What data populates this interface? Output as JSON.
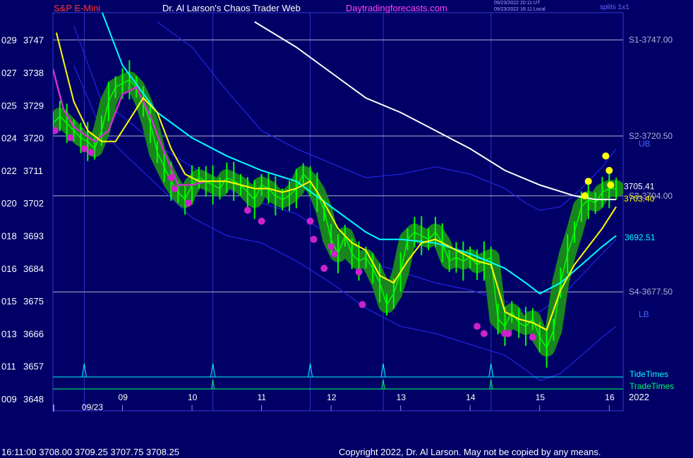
{
  "header": {
    "symbol": "S&P E-Mini",
    "source": "Dr. Al Larson's Chaos Trader Web",
    "site": "Daytradingforecasts.com",
    "time_utc": "09/23/2022 20:11 UT",
    "time_local": "09/23/2022 16:11 Local",
    "splits": "splits 1x1"
  },
  "footer": {
    "quote": "16:11:00  3708.00 3709.25 3707.75 3708.25",
    "copyright": "Copyright 2022, Dr. Al Larson. May not be copied by any means."
  },
  "colors": {
    "background": "#000066",
    "plot_border": "#3a3ad0",
    "price_bar": "#00ff00",
    "glow": "#1a8c1a",
    "mov_avg_fast": "#ffff00",
    "mov_avg_mid": "#00ffff",
    "mov_avg_slow": "#ffffff",
    "mov_avg_magenta": "#cc33cc",
    "band_lines": "#2222dd",
    "support_lines": "#b0b0d8",
    "tide_times": "#00ffff",
    "trade_times": "#00ff66"
  },
  "chart_data": {
    "type": "line",
    "title": "S&P E-Mini",
    "ylim": [
      3648,
      3752
    ],
    "xlim": [
      8.0,
      16.2
    ],
    "y_ticks": [
      {
        "code": "029",
        "price": "3747",
        "v": 3747
      },
      {
        "code": "027",
        "price": "3738",
        "v": 3738
      },
      {
        "code": "025",
        "price": "3729",
        "v": 3729
      },
      {
        "code": "024",
        "price": "3720",
        "v": 3720
      },
      {
        "code": "022",
        "price": "3711",
        "v": 3711
      },
      {
        "code": "020",
        "price": "3702",
        "v": 3702
      },
      {
        "code": "018",
        "price": "3693",
        "v": 3693
      },
      {
        "code": "016",
        "price": "3684",
        "v": 3684
      },
      {
        "code": "015",
        "price": "3675",
        "v": 3675
      },
      {
        "code": "013",
        "price": "3666",
        "v": 3666
      },
      {
        "code": "011",
        "price": "3657",
        "v": 3657
      },
      {
        "code": "009",
        "price": "3648",
        "v": 3648
      }
    ],
    "x_ticks": [
      {
        "label": "09",
        "x": 9
      },
      {
        "label": "10",
        "x": 10
      },
      {
        "label": "11",
        "x": 11
      },
      {
        "label": "12",
        "x": 12
      },
      {
        "label": "13",
        "x": 13
      },
      {
        "label": "14",
        "x": 14
      },
      {
        "label": "15",
        "x": 15
      },
      {
        "label": "16",
        "x": 16
      }
    ],
    "date_label": "09/23",
    "year_label": "2022",
    "levels": [
      {
        "label": "S1-3747.00",
        "value": 3747.0
      },
      {
        "label": "S2-3720.50",
        "value": 3720.5
      },
      {
        "label": "S3-3704.00",
        "value": 3704.0
      },
      {
        "label": "S4-3677.50",
        "value": 3677.5
      }
    ],
    "band_labels": {
      "upper": "UB",
      "lower": "LB"
    },
    "value_labels": [
      {
        "text": "3692.51",
        "value": 3692.51,
        "color": "#00ffff"
      },
      {
        "text": "3705.41",
        "value": 3705.41,
        "color": "#ffffff"
      },
      {
        "text": "3703.40",
        "value": 3703.4,
        "color": "#ffff00"
      }
    ],
    "tide_times_label": "TideTimes",
    "trade_times_label": "TradeTimes",
    "tide_times": [
      8.45,
      10.3,
      11.7,
      12.75,
      14.3
    ],
    "trade_times": [
      10.3,
      12.75,
      14.3
    ],
    "vlines": [
      8.45,
      10.3,
      11.7,
      12.75,
      14.3
    ],
    "series": [
      {
        "type": "price",
        "x": [
          8.0,
          8.1,
          8.2,
          8.3,
          8.4,
          8.5,
          8.6,
          8.7,
          8.8,
          8.9,
          9.0,
          9.1,
          9.2,
          9.3,
          9.4,
          9.5,
          9.6,
          9.7,
          9.8,
          9.9,
          10.0,
          10.1,
          10.2,
          10.3,
          10.4,
          10.5,
          10.6,
          10.7,
          10.8,
          10.9,
          11.0,
          11.1,
          11.2,
          11.3,
          11.4,
          11.5,
          11.6,
          11.7,
          11.8,
          11.9,
          12.0,
          12.1,
          12.2,
          12.3,
          12.4,
          12.5,
          12.6,
          12.7,
          12.8,
          12.9,
          13.0,
          13.1,
          13.2,
          13.3,
          13.4,
          13.5,
          13.6,
          13.7,
          13.8,
          13.9,
          14.0,
          14.1,
          14.2,
          14.3,
          14.4,
          14.5,
          14.6,
          14.7,
          14.8,
          14.9,
          15.0,
          15.1,
          15.2,
          15.3,
          15.4,
          15.5,
          15.6,
          15.7,
          15.8,
          15.9,
          16.0,
          16.1
        ],
        "y": [
          3724,
          3726,
          3724,
          3722,
          3720,
          3719,
          3717,
          3722,
          3730,
          3734,
          3735,
          3736,
          3734,
          3730,
          3724,
          3716,
          3712,
          3708,
          3705,
          3703,
          3707,
          3709,
          3708,
          3707,
          3706,
          3709,
          3708,
          3707,
          3705,
          3703,
          3707,
          3706,
          3704,
          3703,
          3704,
          3706,
          3710,
          3708,
          3705,
          3700,
          3692,
          3688,
          3693,
          3688,
          3686,
          3687,
          3684,
          3680,
          3674,
          3677,
          3683,
          3692,
          3694,
          3693,
          3692,
          3694,
          3691,
          3686,
          3687,
          3686,
          3687,
          3685,
          3686,
          3687,
          3670,
          3668,
          3672,
          3669,
          3668,
          3670,
          3665,
          3662,
          3667,
          3680,
          3688,
          3694,
          3701,
          3703,
          3702,
          3705,
          3706,
          3706
        ]
      },
      {
        "type": "ma_fast",
        "x": [
          8.05,
          8.3,
          8.5,
          8.7,
          8.9,
          9.1,
          9.3,
          9.5,
          9.7,
          9.9,
          10.1,
          10.3,
          10.5,
          10.7,
          10.9,
          11.1,
          11.3,
          11.5,
          11.7,
          11.9,
          12.1,
          12.3,
          12.5,
          12.7,
          12.9,
          13.1,
          13.3,
          13.5,
          13.7,
          13.9,
          14.1,
          14.3,
          14.5,
          14.7,
          14.9,
          15.1,
          15.3,
          15.5,
          15.7,
          15.9,
          16.1
        ],
        "y": [
          3749,
          3730,
          3722,
          3719,
          3719,
          3725,
          3731,
          3727,
          3717,
          3710,
          3708,
          3708,
          3708,
          3707,
          3706,
          3706,
          3705,
          3706,
          3708,
          3702,
          3695,
          3691,
          3689,
          3682,
          3680,
          3686,
          3691,
          3692,
          3690,
          3688,
          3686,
          3685,
          3672,
          3670,
          3669,
          3667,
          3678,
          3685,
          3690,
          3695,
          3701
        ]
      },
      {
        "type": "ma_magenta",
        "x": [
          8.0,
          8.15,
          8.3,
          8.45,
          8.6,
          8.8,
          9.0,
          9.2,
          9.4,
          9.6,
          9.8,
          10.0,
          10.2
        ],
        "y": [
          3739,
          3728,
          3723,
          3721,
          3719,
          3722,
          3732,
          3734,
          3726,
          3716,
          3707,
          3707,
          3708
        ]
      },
      {
        "type": "ma_mid",
        "x": [
          8.7,
          9.0,
          9.5,
          10.0,
          10.5,
          11.0,
          11.5,
          12.0,
          12.5,
          12.7,
          13.0,
          13.5,
          14.0,
          14.5,
          14.8,
          15.0,
          15.3,
          15.6,
          15.9,
          16.1
        ],
        "y": [
          3755,
          3740,
          3727,
          3720,
          3715,
          3711,
          3708,
          3701,
          3694,
          3692,
          3692,
          3691,
          3688,
          3684,
          3680,
          3677,
          3680,
          3685,
          3690,
          3693
        ]
      },
      {
        "type": "ma_slow",
        "x": [
          10.9,
          11.5,
          12.0,
          12.5,
          13.0,
          13.5,
          14.0,
          14.5,
          15.0,
          15.5,
          15.8,
          16.0,
          16.1
        ],
        "y": [
          3752,
          3745,
          3738,
          3731,
          3727,
          3722,
          3717,
          3711,
          3707,
          3704,
          3703,
          3703,
          3703
        ]
      },
      {
        "type": "band_upper",
        "x": [
          9.5,
          10.0,
          10.5,
          11.0,
          11.5,
          12.0,
          12.5,
          13.0,
          13.5,
          14.0,
          14.5,
          14.8,
          15.0,
          15.3,
          15.6,
          15.9,
          16.1
        ],
        "y": [
          3752,
          3745,
          3733,
          3722,
          3717,
          3713,
          3709,
          3710,
          3712,
          3710,
          3706,
          3702,
          3700,
          3701,
          3706,
          3712,
          3717
        ]
      },
      {
        "type": "band_middle",
        "x": [
          8.3,
          8.7,
          9.0,
          9.5,
          10.0,
          10.5,
          11.0,
          11.5,
          12.0,
          12.5,
          13.0,
          13.5,
          14.0,
          14.5,
          14.8,
          15.0,
          15.3,
          15.6,
          15.9,
          16.1
        ],
        "y": [
          3751,
          3730,
          3726,
          3718,
          3712,
          3706,
          3702,
          3699,
          3693,
          3686,
          3683,
          3680,
          3678,
          3675,
          3672,
          3672,
          3676,
          3682,
          3688,
          3692
        ]
      },
      {
        "type": "band_lower",
        "x": [
          8.3,
          8.7,
          9.0,
          9.5,
          10.0,
          10.5,
          11.0,
          11.5,
          12.0,
          12.5,
          13.0,
          13.5,
          14.0,
          14.5,
          14.8,
          15.0,
          15.3,
          15.6,
          15.9,
          16.1
        ],
        "y": [
          3740,
          3722,
          3716,
          3707,
          3698,
          3693,
          3691,
          3686,
          3680,
          3673,
          3668,
          3666,
          3663,
          3660,
          3656,
          3653,
          3655,
          3660,
          3665,
          3668
        ]
      }
    ],
    "highlight_lows": {
      "x": [
        8.03,
        8.25,
        8.45,
        8.55,
        9.7,
        9.75,
        9.95,
        10.8,
        11.0,
        11.7,
        11.75,
        11.9,
        12.0,
        12.05,
        12.4,
        12.45,
        14.1,
        14.2,
        14.5,
        14.55,
        14.9
      ],
      "y": [
        3722,
        3720,
        3717,
        3716,
        3709,
        3706,
        3702,
        3700,
        3697,
        3697,
        3692,
        3684,
        3690,
        3688,
        3683,
        3674,
        3668,
        3666,
        3666,
        3666,
        3665
      ]
    },
    "highlight_highs": {
      "x": [
        15.65,
        15.7,
        15.95,
        16.0,
        16.02
      ],
      "y": [
        3704,
        3708,
        3715,
        3711,
        3707
      ]
    }
  }
}
